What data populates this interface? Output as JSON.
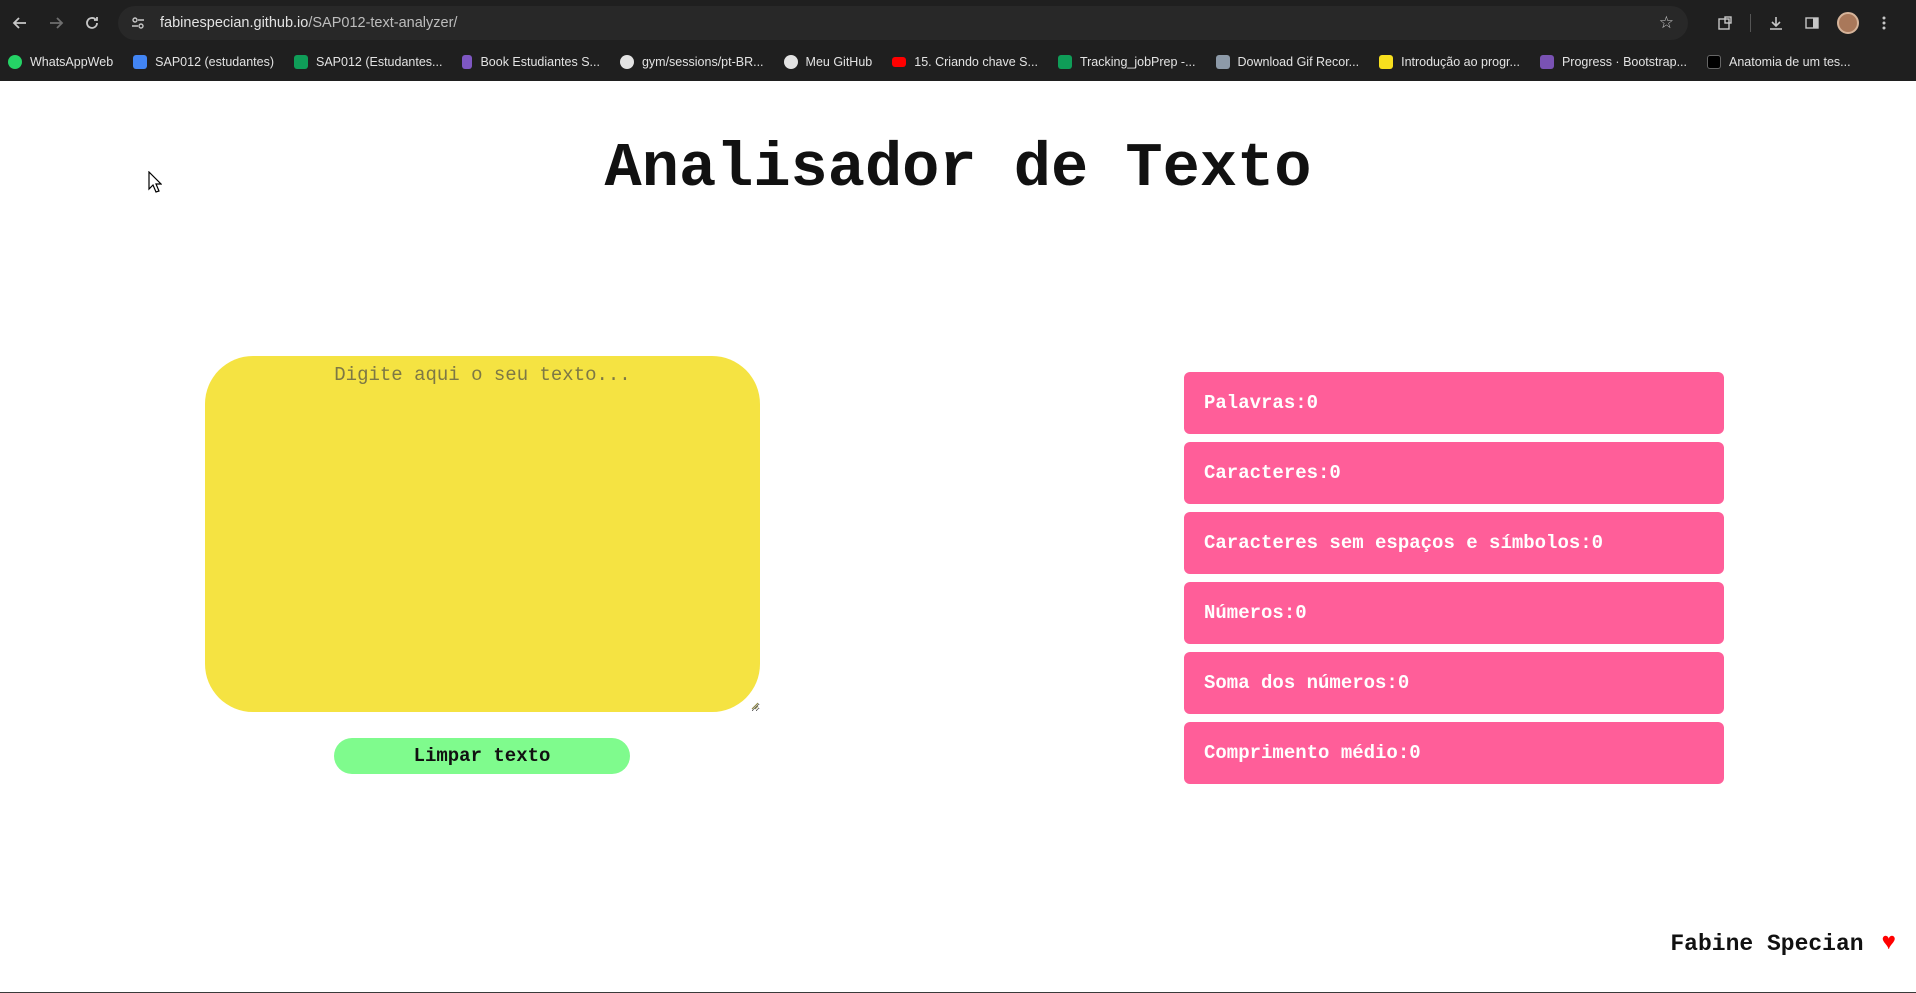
{
  "browser": {
    "url_host": "fabinespecian.github.io",
    "url_path": "/SAP012-text-analyzer/",
    "bookmarks": [
      {
        "label": "WhatsAppWeb",
        "icon": "whatsapp-icon",
        "color": "#25d366"
      },
      {
        "label": "SAP012 (estudantes)",
        "icon": "calendar-icon",
        "color": "#4285f4"
      },
      {
        "label": "SAP012 (Estudantes...",
        "icon": "sheets-icon",
        "color": "#0f9d58"
      },
      {
        "label": "Book Estudiantes S...",
        "icon": "book-icon",
        "color": "#7e57c2"
      },
      {
        "label": "gym/sessions/pt-BR...",
        "icon": "github-icon",
        "color": "#e3e3e3"
      },
      {
        "label": "Meu GitHub",
        "icon": "github-icon",
        "color": "#e3e3e3"
      },
      {
        "label": "15. Criando chave S...",
        "icon": "youtube-icon",
        "color": "#ff0000"
      },
      {
        "label": "Tracking_jobPrep -...",
        "icon": "sheets-icon",
        "color": "#0f9d58"
      },
      {
        "label": "Download Gif Recor...",
        "icon": "image-icon",
        "color": "#8d9aa8"
      },
      {
        "label": "Introdução ao progr...",
        "icon": "code-icon",
        "color": "#f7df1e"
      },
      {
        "label": "Progress · Bootstrap...",
        "icon": "bootstrap-icon",
        "color": "#7952b3"
      },
      {
        "label": "Anatomia de um tes...",
        "icon": "dev-icon",
        "color": "#000000"
      }
    ]
  },
  "page": {
    "title": "Analisador de Texto",
    "textarea": {
      "placeholder": "Digite aqui o seu texto...",
      "value": ""
    },
    "clear_button": "Limpar texto",
    "stats": [
      {
        "label": "Palavras:0"
      },
      {
        "label": "Caracteres:0"
      },
      {
        "label": "Caracteres sem espaços e símbolos:0"
      },
      {
        "label": "Números:0"
      },
      {
        "label": "Soma dos números:0"
      },
      {
        "label": "Comprimento médio:0"
      }
    ],
    "footer": {
      "author": "Fabine Specian",
      "heart": "♥"
    }
  },
  "colors": {
    "textarea_bg": "#f5e342",
    "button_bg": "#7ffb8d",
    "stat_bg": "#ff5e99",
    "heart": "#ff0000"
  }
}
